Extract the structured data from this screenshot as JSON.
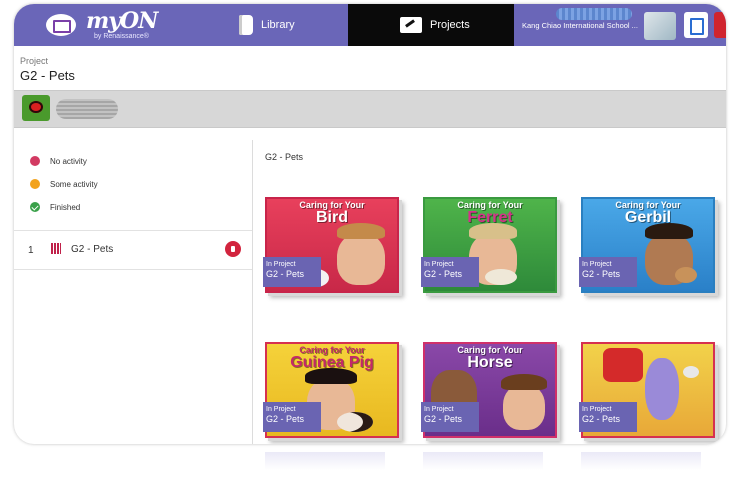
{
  "app": {
    "logo_text": "myON",
    "logo_sub": "by Renaissance®"
  },
  "nav": {
    "library": "Library",
    "projects": "Projects",
    "school": "Kang Chiao International School ..."
  },
  "project": {
    "label": "Project",
    "title": "G2 - Pets"
  },
  "legend": [
    {
      "label": "No activity",
      "color": "#d23a62"
    },
    {
      "label": "Some activity",
      "color": "#f2a21c"
    },
    {
      "label": "Finished",
      "color": "#3aa14a"
    }
  ],
  "list": [
    {
      "num": "1",
      "name": "G2 - Pets",
      "status": "no-activity"
    }
  ],
  "main": {
    "title": "G2 - Pets"
  },
  "books": [
    {
      "line1": "Caring for Your",
      "line2": "Bird",
      "badge1": "In Project",
      "badge2": "G2 - Pets",
      "color": "#d63250"
    },
    {
      "line1": "Caring for Your",
      "line2": "Ferret",
      "badge1": "In Project",
      "badge2": "G2 - Pets",
      "color": "#3fa044"
    },
    {
      "line1": "Caring for Your",
      "line2": "Gerbil",
      "badge1": "In Project",
      "badge2": "G2 - Pets",
      "color": "#2f8fcf"
    },
    {
      "line1": "Caring for Your",
      "line2": "Guinea Pig",
      "badge1": "In Project",
      "badge2": "G2 - Pets",
      "color": "#f0c62a"
    },
    {
      "line1": "Caring for Your",
      "line2": "Horse",
      "badge1": "In Project",
      "badge2": "G2 - Pets",
      "color": "#8a3a9a"
    },
    {
      "line1": "",
      "line2": "",
      "badge1": "In Project",
      "badge2": "G2 - Pets",
      "color": "#e2402c"
    }
  ],
  "colors": {
    "topbar": "#6a66b8",
    "active_tab": "#0a0a0a",
    "badge": "#6a64b2"
  }
}
